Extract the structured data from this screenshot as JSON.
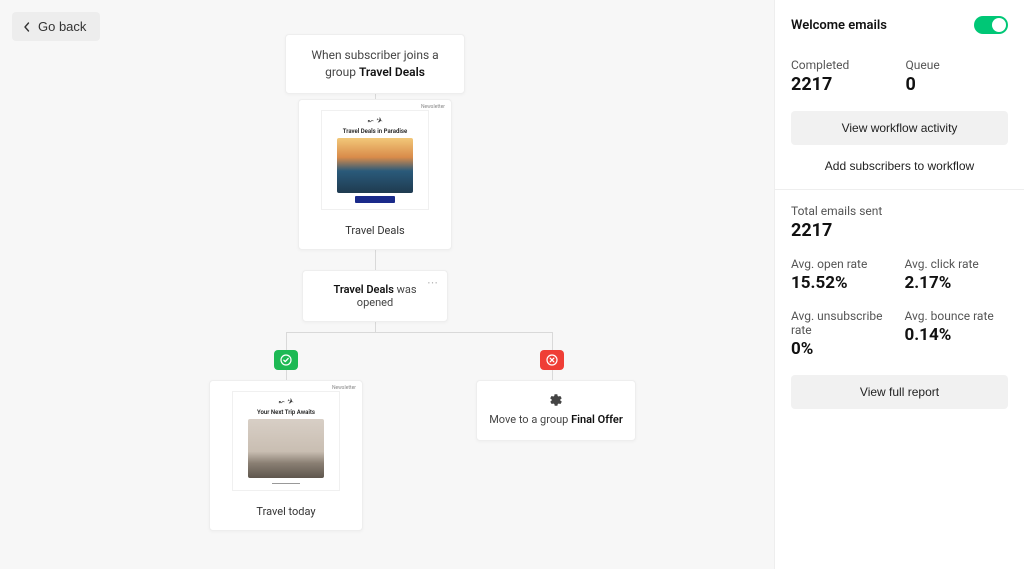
{
  "back_button": "Go back",
  "trigger": {
    "prefix": "When subscriber joins a group ",
    "group": "Travel Deals"
  },
  "emails": {
    "e1": {
      "thumb_label": "Newsletter",
      "headline": "Travel Deals in Paradise",
      "caption": "Travel Deals"
    },
    "e2": {
      "thumb_label": "Newsletter",
      "headline": "Your Next Trip Awaits",
      "caption": "Travel today"
    }
  },
  "condition": {
    "subject": "Travel Deals",
    "suffix": " was opened"
  },
  "action": {
    "prefix": "Move to a group ",
    "target": "Final Offer"
  },
  "sidebar": {
    "title": "Welcome emails",
    "completed_label": "Completed",
    "completed_value": "2217",
    "queue_label": "Queue",
    "queue_value": "0",
    "view_activity": "View workflow activity",
    "add_subs": "Add subscribers to workflow",
    "total_label": "Total emails sent",
    "total_value": "2217",
    "open_label": "Avg. open rate",
    "open_value": "15.52%",
    "click_label": "Avg. click rate",
    "click_value": "2.17%",
    "unsub_label": "Avg. unsubscribe rate",
    "unsub_value": "0%",
    "bounce_label": "Avg. bounce rate",
    "bounce_value": "0.14%",
    "full_report": "View full report"
  }
}
